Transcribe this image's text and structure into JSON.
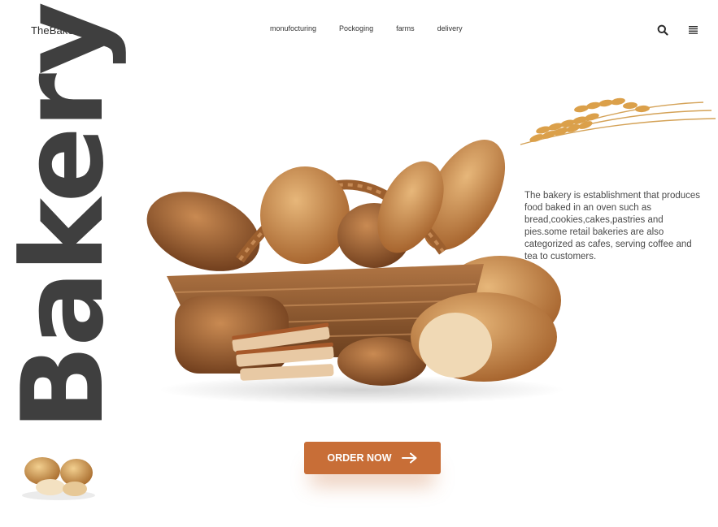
{
  "header": {
    "brand": "TheBakery",
    "nav": [
      {
        "label": "monufocturing"
      },
      {
        "label": "Pockoging"
      },
      {
        "label": "farms"
      },
      {
        "label": "delivery"
      }
    ],
    "icons": {
      "search": "search-icon",
      "menu": "menu-icon"
    }
  },
  "hero": {
    "title": "Bakery",
    "description": "The bakery is establishment that produces food baked in an oven such as bread,cookies,cakes,pastries and pies.some retail bakeries are also categorized as cafes, serving coffee and tea to customers.",
    "cta_label": "ORDER NOW",
    "cta_icon": "arrow-right-icon"
  },
  "colors": {
    "accent": "#c86e37",
    "title": "#3f3f3f",
    "text": "#4a4a4a"
  }
}
